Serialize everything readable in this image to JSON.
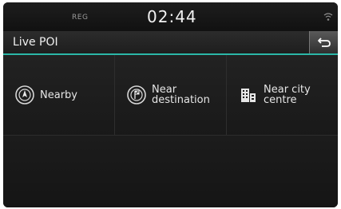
{
  "status_bar": {
    "reg": "REG",
    "time": "02:44"
  },
  "header": {
    "title": "Live POI"
  },
  "options": [
    {
      "line1": "Nearby",
      "line2": "",
      "icon": "compass-icon"
    },
    {
      "line1": "Near",
      "line2": "destination",
      "icon": "destination-flag-icon"
    },
    {
      "line1": "Near city",
      "line2": "centre",
      "icon": "city-buildings-icon"
    }
  ],
  "colors": {
    "accent": "#2bb7a8",
    "background": "#1d1d1d"
  }
}
